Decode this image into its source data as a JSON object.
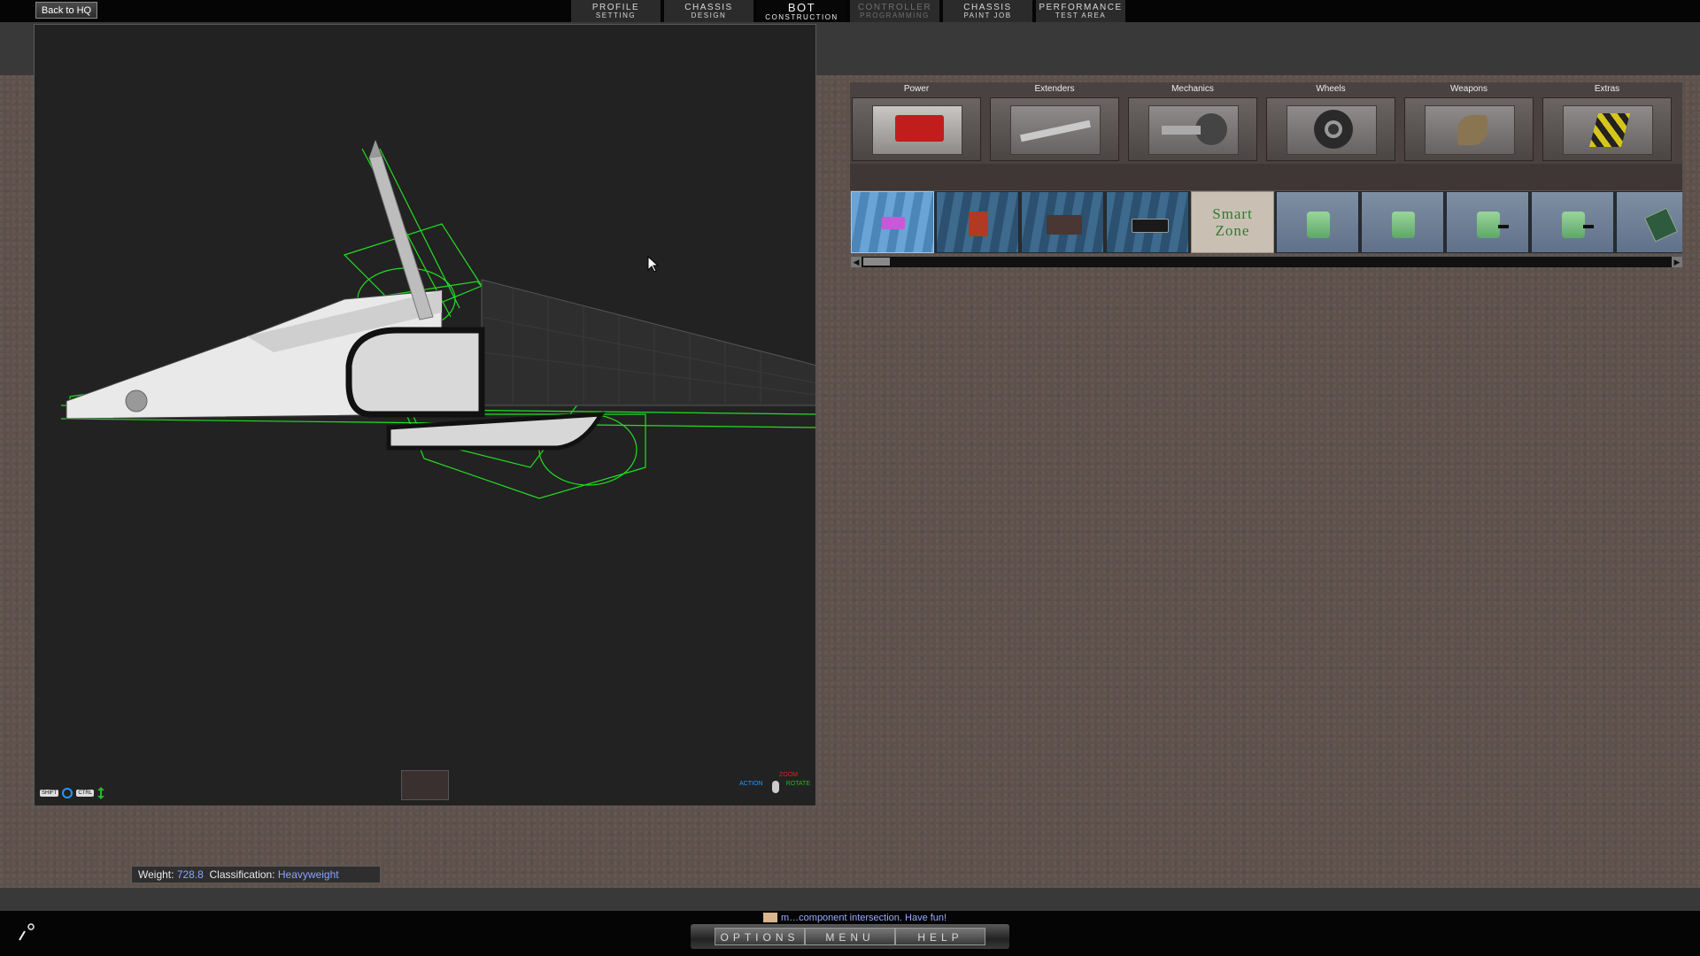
{
  "topbar": {
    "back_label": "Back to HQ",
    "tabs": [
      {
        "line1": "PROFILE",
        "line2": "SETTING",
        "state": "normal"
      },
      {
        "line1": "CHASSIS",
        "line2": "DESIGN",
        "state": "normal"
      },
      {
        "line1": "BOT",
        "line2": "CONSTRUCTION",
        "state": "active"
      },
      {
        "line1": "CONTROLLER",
        "line2": "PROGRAMMING",
        "state": "disabled"
      },
      {
        "line1": "CHASSIS",
        "line2": "PAINT JOB",
        "state": "normal"
      },
      {
        "line1": "PERFORMANCE",
        "line2": "TEST AREA",
        "state": "normal"
      }
    ]
  },
  "viewport": {
    "hint_left": {
      "key1": "SHIFT",
      "icon1": "rotate-icon",
      "key2": "CTRL",
      "icon2": "vertical-arrows-icon"
    },
    "hint_right": {
      "zoom": "ZOOM",
      "rotate": "ROTATE",
      "action": "ACTION"
    },
    "wireframe_color": "#22dd22"
  },
  "parts": {
    "categories": [
      {
        "label": "Power",
        "icon": "battery-icon"
      },
      {
        "label": "Extenders",
        "icon": "extender-bar-icon"
      },
      {
        "label": "Mechanics",
        "icon": "motor-icon"
      },
      {
        "label": "Wheels",
        "icon": "wheel-icon"
      },
      {
        "label": "Weapons",
        "icon": "blade-icon"
      },
      {
        "label": "Extras",
        "icon": "extras-icon"
      }
    ],
    "items": [
      {
        "type": "part",
        "icon": "pink-battery-icon",
        "selected": true
      },
      {
        "type": "part",
        "icon": "red-battery-icon",
        "selected": false
      },
      {
        "type": "part",
        "icon": "large-battery-icon",
        "selected": false
      },
      {
        "type": "part",
        "icon": "black-battery-icon",
        "selected": false
      },
      {
        "type": "smart",
        "line1": "Smart",
        "line2": "Zone"
      },
      {
        "type": "chip",
        "icon": "green-chip-icon"
      },
      {
        "type": "chip",
        "icon": "green-chip-icon"
      },
      {
        "type": "chip",
        "icon": "green-chip-pin-icon"
      },
      {
        "type": "chip",
        "icon": "green-chip-pin-icon"
      },
      {
        "type": "part",
        "icon": "circuit-board-icon",
        "selected": false
      }
    ]
  },
  "weight": {
    "label": "Weight:",
    "value": "728.8",
    "class_label": "Classification:",
    "class_value": "Heavyweight"
  },
  "status": {
    "message": "m…component intersection. Have fun!"
  },
  "menu": {
    "buttons": [
      "OPTIONS",
      "MENU",
      "HELP"
    ]
  },
  "colors": {
    "accent_value": "#8aa4ff",
    "wireframe": "#22dd22"
  }
}
